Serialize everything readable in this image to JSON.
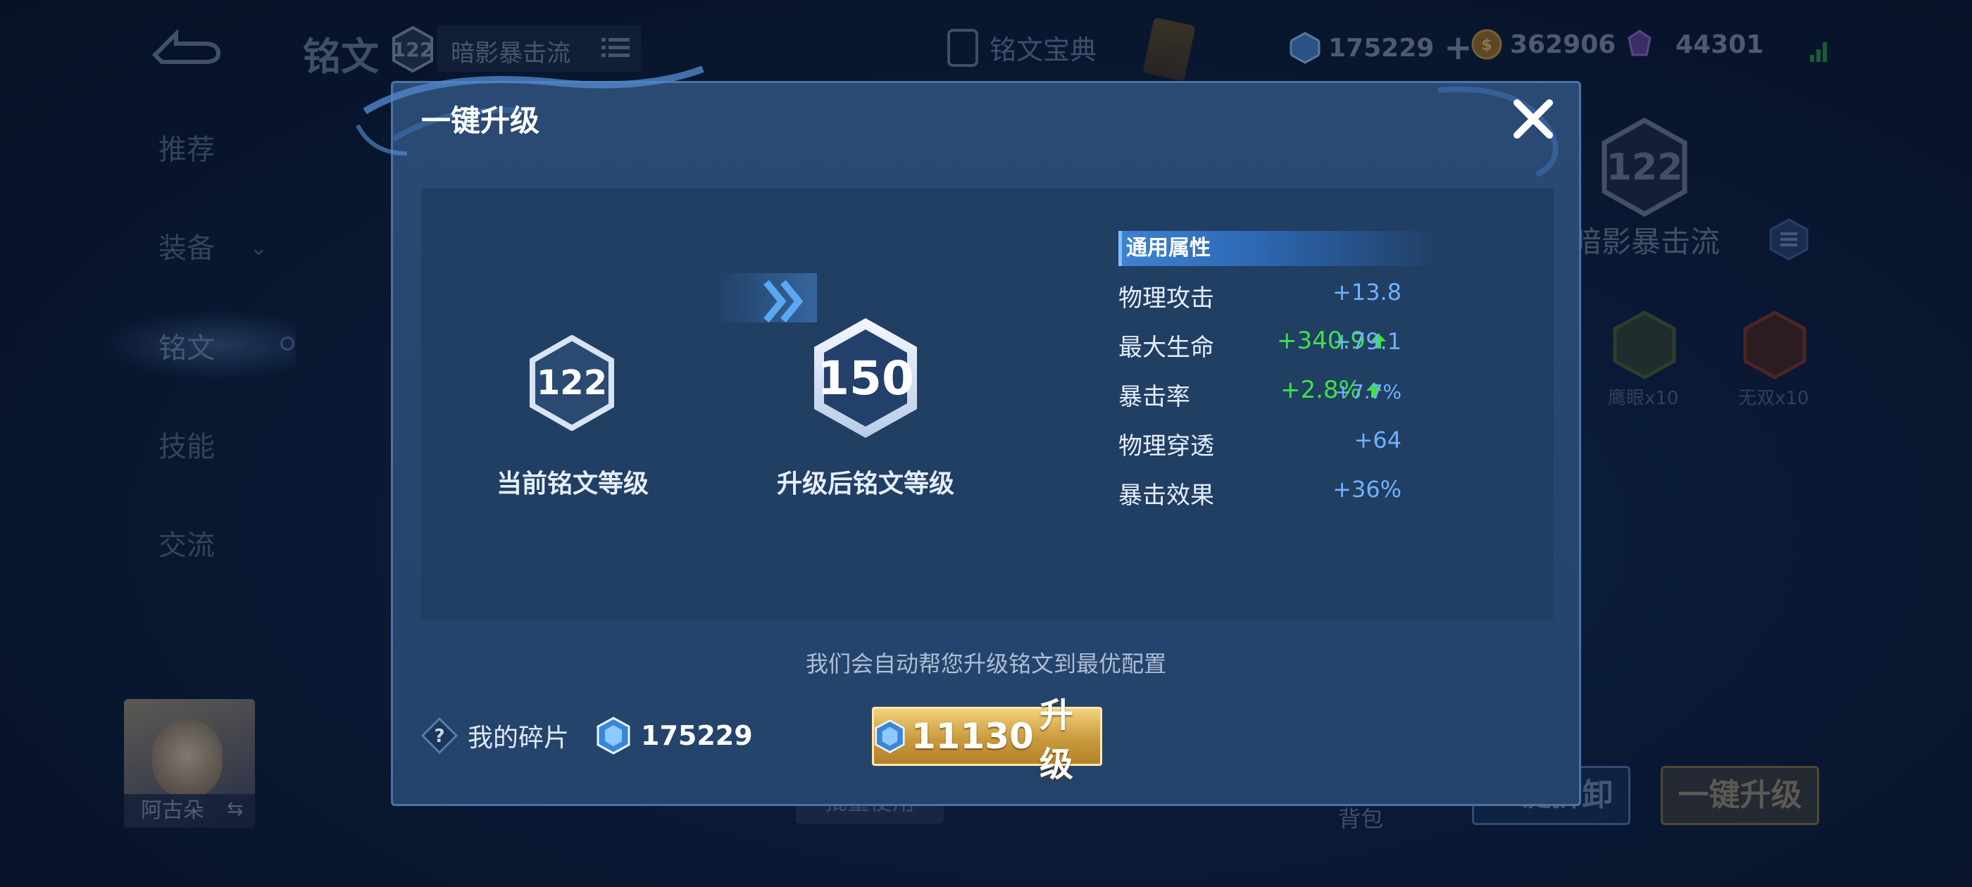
{
  "background": {
    "title": "铭文",
    "level": "122",
    "preset_name": "暗影暴击流",
    "codex_label": "铭文宝典",
    "currencies": [
      {
        "icon": "crystal-icon",
        "value": "175229",
        "has_plus": true
      },
      {
        "icon": "gold-coin-icon",
        "value": "362906"
      },
      {
        "icon": "gem-icon",
        "value": "44301"
      }
    ],
    "side_nav": [
      "推荐",
      "装备",
      "铭文",
      "技能",
      "交流"
    ],
    "active_nav": "铭文",
    "right_panel": {
      "level": "122",
      "preset_name": "暗影暴击流",
      "rune_slots": [
        {
          "label": "鹰眼x10",
          "color": "#4b6a3a"
        },
        {
          "label": "无双x10",
          "color": "#8a3a2a"
        }
      ]
    },
    "hero_name": "阿古朵",
    "bottom_buttons": [
      "批量使用",
      "背包",
      "一键拆卸",
      "一键升级"
    ]
  },
  "dialog": {
    "title": "一键升级",
    "current_level": "122",
    "current_level_label": "当前铭文等级",
    "next_level": "150",
    "next_level_label": "升级后铭文等级",
    "stats_header": "通用属性",
    "stats": [
      {
        "name": "物理攻击",
        "delta": "",
        "value": "+13.8",
        "small": false
      },
      {
        "name": "最大生命",
        "delta": "+340.9",
        "value": "+79.1",
        "small": false
      },
      {
        "name": "暴击率",
        "delta": "+2.8%",
        "value": "+7.7%",
        "small": true
      },
      {
        "name": "物理穿透",
        "delta": "",
        "value": "+64",
        "small": false
      },
      {
        "name": "暴击效果",
        "delta": "",
        "value": "+36%",
        "small": false
      }
    ],
    "auto_note": "我们会自动帮您升级铭文到最优配置",
    "shards_label": "我的碎片",
    "shards_value": "175229",
    "upgrade_cost": "11130",
    "upgrade_label": "升级"
  },
  "colors": {
    "accent_blue": "#6fb2ff",
    "increase_green": "#3fe04a",
    "gold_button": "#c99a3d"
  }
}
